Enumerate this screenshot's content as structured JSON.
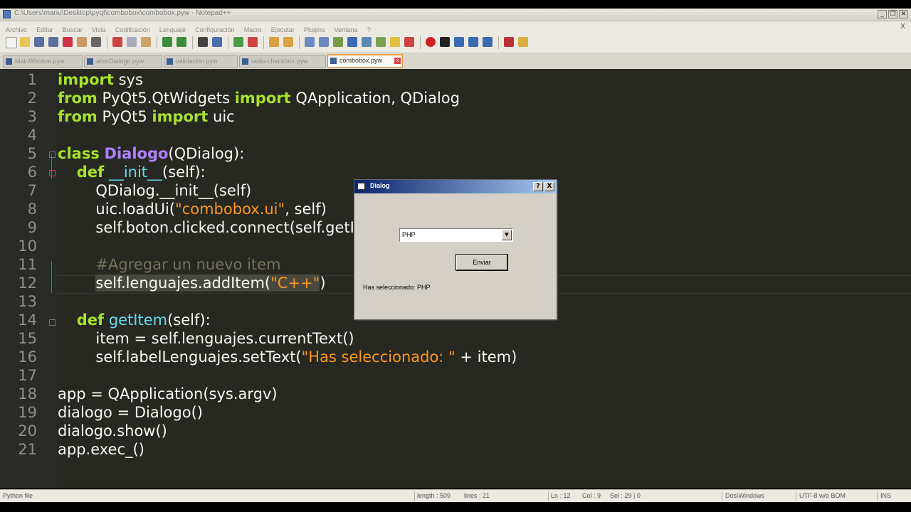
{
  "window": {
    "title": "C:\\Users\\manu\\Desktop\\pyqt\\combobox\\combobox.pyw - Notepad++",
    "controls": [
      "_",
      "❐",
      "✕"
    ]
  },
  "menu": {
    "items": [
      "Archivo",
      "Editar",
      "Buscar",
      "Vista",
      "Codificación",
      "Lenguaje",
      "Configuración",
      "Macro",
      "Ejecutar",
      "Plugins",
      "Ventana",
      "?"
    ],
    "close": "X"
  },
  "tabs": [
    {
      "label": "MainWindow.pyw",
      "active": false
    },
    {
      "label": "abrirDialogo.pyw",
      "active": false
    },
    {
      "label": "validacion.pyw",
      "active": false
    },
    {
      "label": "radio-checkbox.pyw",
      "active": false
    },
    {
      "label": "combobox.pyw",
      "active": true
    }
  ],
  "editor": {
    "lines": [
      "1",
      "2",
      "3",
      "4",
      "5",
      "6",
      "7",
      "8",
      "9",
      "10",
      "11",
      "12",
      "13",
      "14",
      "15",
      "16",
      "17",
      "18",
      "19",
      "20",
      "21"
    ],
    "colors": {
      "background": "#272822",
      "keyword": "#a6e22e",
      "class": "#ae81ff",
      "function": "#66d9ef",
      "string": "#fd971f",
      "comment": "#75715e"
    },
    "code": {
      "l1": {
        "kw": "import",
        "rest": " sys"
      },
      "l2": {
        "kw1": "from",
        "mod": " PyQt5.QtWidgets ",
        "kw2": "import",
        "rest": " QApplication, QDialog"
      },
      "l3": {
        "kw1": "from",
        "mod": " PyQt5 ",
        "kw2": "import",
        "rest": " uic"
      },
      "l5": {
        "kw": "class",
        "name": "Dialogo",
        "rest": "(QDialog):"
      },
      "l6": {
        "indent": "    ",
        "kw": "def",
        "name": "__init__",
        "rest": "(self):"
      },
      "l7": {
        "text": "        QDialog.__init__(self)"
      },
      "l8": {
        "pre": "        uic.loadUi(",
        "str": "\"combobox.ui\"",
        "post": ", self)"
      },
      "l9": {
        "text": "        self.boton.clicked.connect(self.getItem)"
      },
      "l11": {
        "indent": "        ",
        "cmt": "#Agregar un nuevo item"
      },
      "l12": {
        "indent": "        ",
        "pre": "self.lenguajes.addItem(",
        "str": "\"C++\"",
        "post": ")"
      },
      "l14": {
        "indent": "    ",
        "kw": "def",
        "name": "getItem",
        "rest": "(self):"
      },
      "l15": {
        "text": "        item = self.lenguajes.currentText()"
      },
      "l16": {
        "pre": "        self.labelLenguajes.setText(",
        "str": "\"Has seleccionado: \"",
        "post": " + item)"
      },
      "l18": {
        "text": "app = QApplication(sys.argv)"
      },
      "l19": {
        "text": "dialogo = Dialogo()"
      },
      "l20": {
        "text": "dialogo.show()"
      },
      "l21": {
        "text": "app.exec_()"
      }
    }
  },
  "dialog": {
    "title": "Dialog",
    "help_btn": "?",
    "close_btn": "X",
    "combo_value": "PHP",
    "combo_arrow": "▼",
    "button": "Enviar",
    "label": "Has seleccionado: PHP"
  },
  "status": {
    "file_type": "Python file",
    "length": "length : 509",
    "lines": "lines : 21",
    "ln": "Ln : 12",
    "col": "Col : 9",
    "sel": "Sel : 29 | 0",
    "eol": "Dos\\Windows",
    "encoding": "UTF-8 w/o BOM",
    "mode": "INS"
  }
}
